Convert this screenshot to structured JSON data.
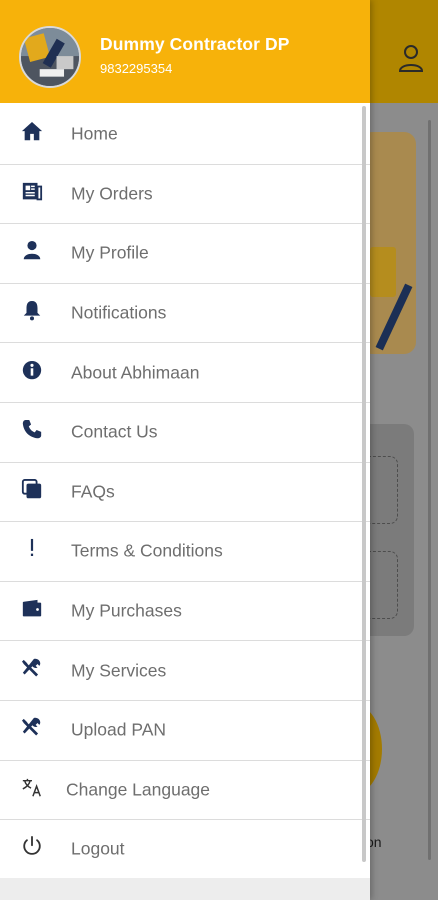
{
  "header": {
    "user_name": "Dummy Contractor DP",
    "phone": "9832295354",
    "accent_color": "#f7b20a"
  },
  "menu": {
    "items": [
      {
        "label": "Home",
        "icon": "home-icon"
      },
      {
        "label": "My Orders",
        "icon": "orders-icon"
      },
      {
        "label": "My Profile",
        "icon": "person-icon"
      },
      {
        "label": "Notifications",
        "icon": "bell-icon"
      },
      {
        "label": "About Abhimaan",
        "icon": "info-icon"
      },
      {
        "label": "Contact Us",
        "icon": "phone-icon"
      },
      {
        "label": "FAQs",
        "icon": "copy-icon"
      },
      {
        "label": "Terms & Conditions",
        "icon": "exclamation-icon"
      },
      {
        "label": "My Purchases",
        "icon": "wallet-icon"
      },
      {
        "label": "My Services",
        "icon": "tools-icon"
      },
      {
        "label": "Upload PAN",
        "icon": "tools-icon"
      },
      {
        "label": "Change Language",
        "icon": "translate-icon"
      },
      {
        "label": "Logout",
        "icon": "power-icon"
      }
    ],
    "icon_color": "#1e3159",
    "label_color": "#6e6e6e"
  },
  "background": {
    "partial_text": "on"
  }
}
